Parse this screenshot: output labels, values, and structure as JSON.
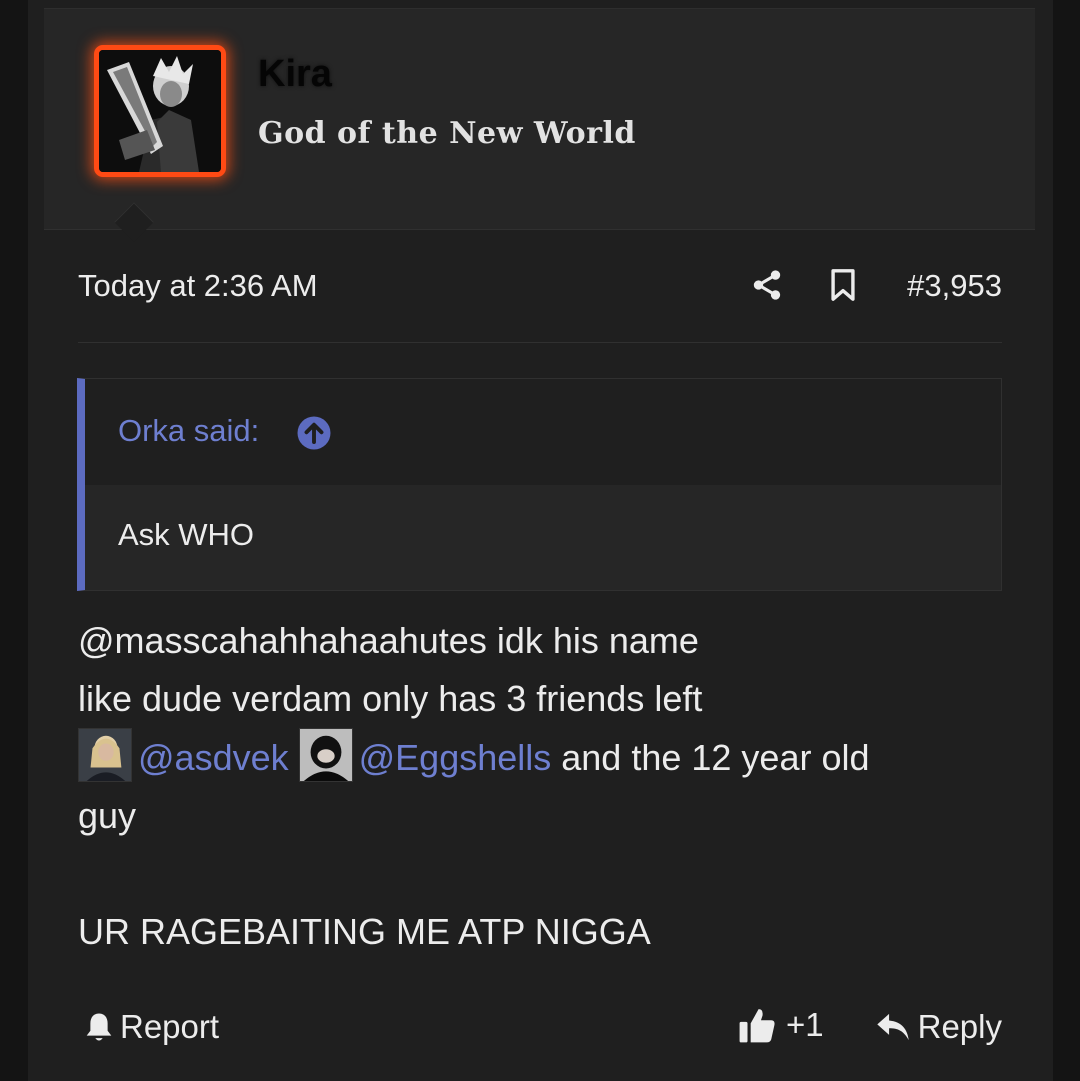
{
  "post": {
    "user": {
      "name": "Kira",
      "title": "God of the New World"
    },
    "timestamp": "Today at 2:36 AM",
    "post_number": "#3,953",
    "quote": {
      "author_label": "Orka said:",
      "text": "Ask WHO"
    },
    "message": {
      "line1": "@masscahahhahaahutes idk his name",
      "line2": "like dude verdam only has 3 friends left",
      "mention1": "@asdvek",
      "mention2": "@Eggshells",
      "line3_tail": " and the 12 year old",
      "line4": "guy",
      "line5": "UR RAGEBAITING ME ATP NIGGA"
    },
    "footer": {
      "report_label": "Report",
      "like_count": "+1",
      "reply_label": "Reply"
    }
  },
  "colors": {
    "accent": "#5c6bc0",
    "mention": "#6e7fd0",
    "avatar_glow": "#ff4a14",
    "background": "#1f1f1f"
  },
  "icons": {
    "share": "share-icon",
    "bookmark": "bookmark-icon",
    "quote_jump": "arrow-up-circle-icon",
    "report": "bell-icon",
    "like": "thumbs-up-icon",
    "reply": "reply-arrow-icon"
  }
}
